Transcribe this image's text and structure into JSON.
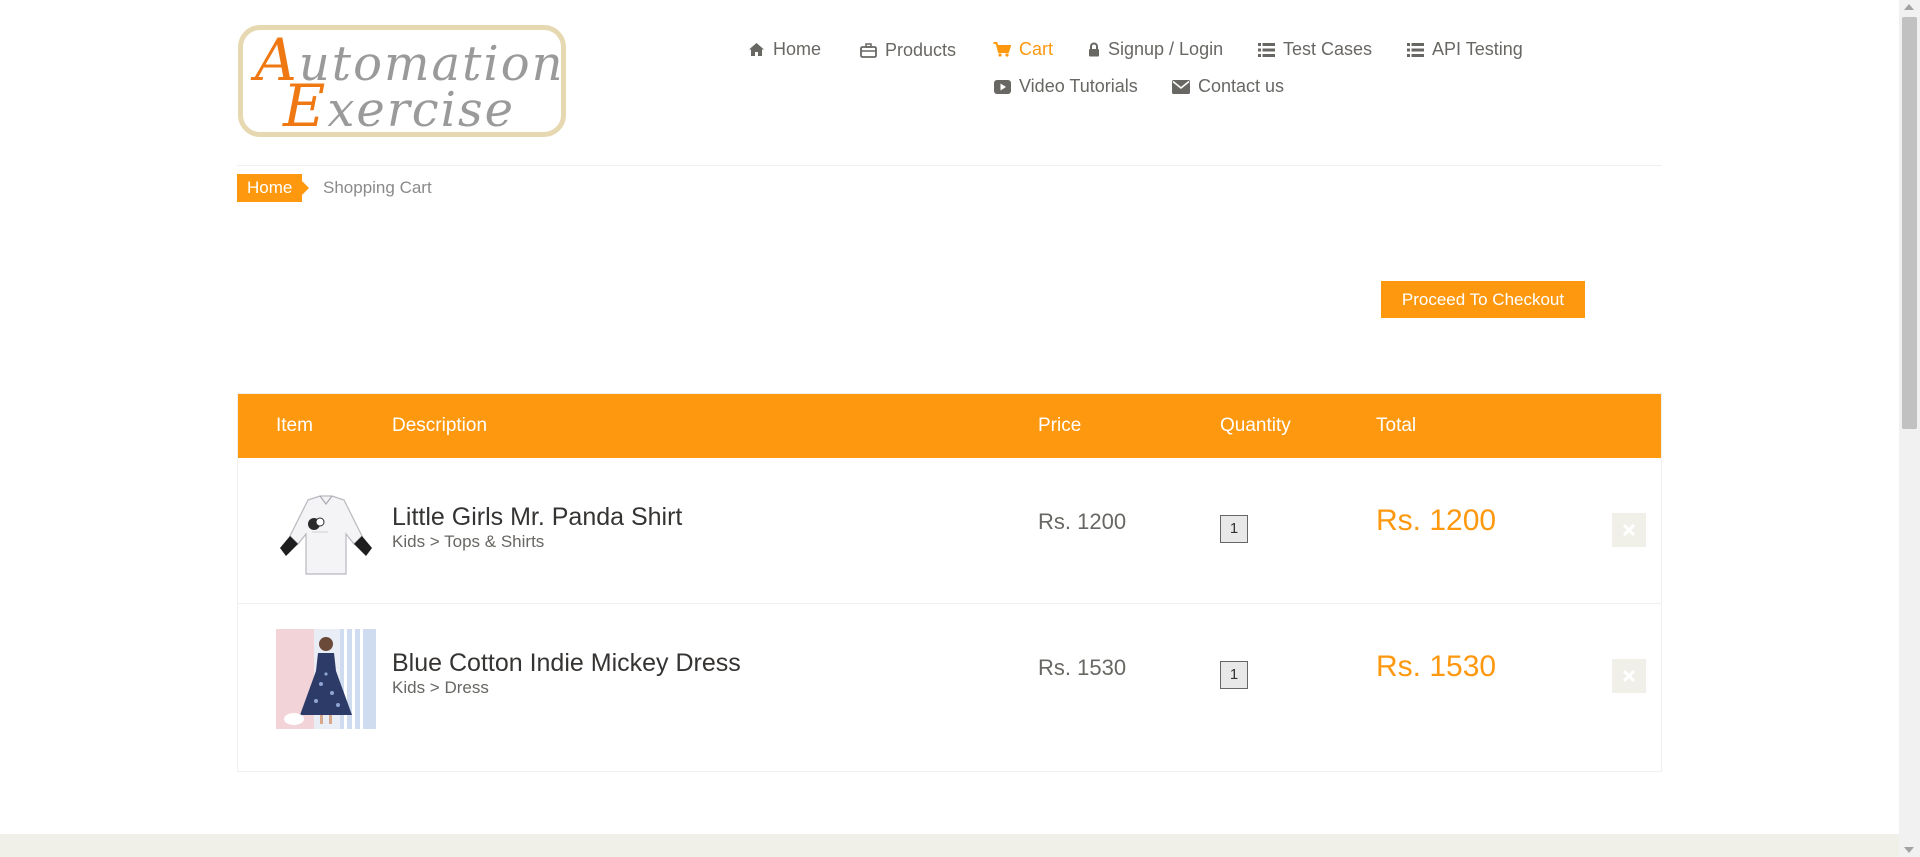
{
  "brand": {
    "logo_line1_cap": "A",
    "logo_line1_rest": "utomation",
    "logo_line2_cap": "E",
    "logo_line2_rest": "xercise",
    "accent_color": "#fe980f"
  },
  "nav": {
    "home": "Home",
    "products": "Products",
    "cart": "Cart",
    "signup_login": "Signup / Login",
    "test_cases": "Test Cases",
    "api_testing": "API Testing",
    "video_tutorials": "Video Tutorials",
    "contact_us": "Contact us",
    "active": "cart"
  },
  "breadcrumb": {
    "home": "Home",
    "current": "Shopping Cart"
  },
  "checkout_button": "Proceed To Checkout",
  "cart": {
    "columns": [
      "Item",
      "Description",
      "Price",
      "Quantity",
      "Total"
    ],
    "items": [
      {
        "name": "Little Girls Mr. Panda Shirt",
        "category": "Kids > Tops & Shirts",
        "price": "Rs. 1200",
        "quantity": "1",
        "total": "Rs. 1200"
      },
      {
        "name": "Blue Cotton Indie Mickey Dress",
        "category": "Kids > Dress",
        "price": "Rs. 1530",
        "quantity": "1",
        "total": "Rs. 1530"
      }
    ]
  }
}
